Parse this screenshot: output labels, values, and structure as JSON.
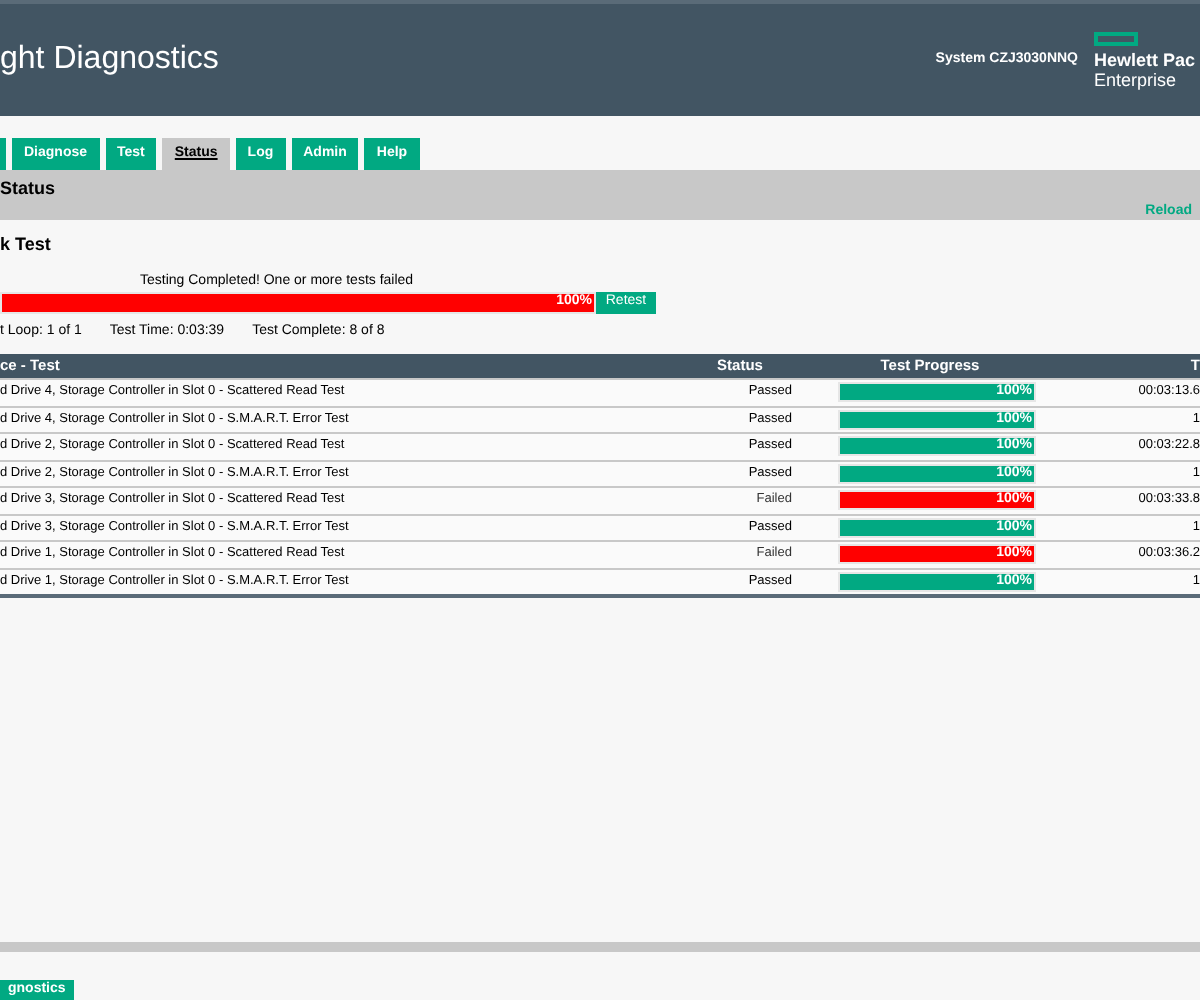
{
  "header": {
    "title": "ght Diagnostics",
    "system": "System CZJ3030NNQ",
    "logo_line_1": "Hewlett Pac",
    "logo_line_2": "Enterprise"
  },
  "tabs": [
    {
      "label": "Diagnose",
      "selected": false
    },
    {
      "label": "Test",
      "selected": false
    },
    {
      "label": "Status",
      "selected": true
    },
    {
      "label": "Log",
      "selected": false
    },
    {
      "label": "Admin",
      "selected": false
    },
    {
      "label": "Help",
      "selected": false
    }
  ],
  "section": {
    "title": "Status",
    "reload": "Reload"
  },
  "test": {
    "title": "k Test",
    "message": "Testing Completed! One or more tests failed",
    "progress": {
      "level": 1,
      "reading": "100%",
      "failed": true
    },
    "retest": "Retest",
    "loop": "t Loop: 1 of 1",
    "time": "Test Time: 0:03:39",
    "complete": "Test Complete: 8 of 8"
  },
  "table": {
    "columns": [
      "ce - Test",
      "Status",
      "Test Progress",
      "T"
    ],
    "rows": [
      {
        "test": "d Drive 4, Storage Controller in Slot 0 - Scattered Read Test",
        "status": "Passed",
        "failed": false,
        "level": 1,
        "reading": "100%",
        "time": "00:03:13.6"
      },
      {
        "test": "d Drive 4, Storage Controller in Slot 0 - S.M.A.R.T. Error Test",
        "status": "Passed",
        "failed": false,
        "level": 1,
        "reading": "100%",
        "time": "1"
      },
      {
        "test": "d Drive 2, Storage Controller in Slot 0 - Scattered Read Test",
        "status": "Passed",
        "failed": false,
        "level": 1,
        "reading": "100%",
        "time": "00:03:22.8"
      },
      {
        "test": "d Drive 2, Storage Controller in Slot 0 - S.M.A.R.T. Error Test",
        "status": "Passed",
        "failed": false,
        "level": 1,
        "reading": "100%",
        "time": "1"
      },
      {
        "test": "d Drive 3, Storage Controller in Slot 0 - Scattered Read Test",
        "status": "Failed",
        "failed": true,
        "level": 1,
        "reading": "100%",
        "time": "00:03:33.8"
      },
      {
        "test": "d Drive 3, Storage Controller in Slot 0 - S.M.A.R.T. Error Test",
        "status": "Passed",
        "failed": false,
        "level": 1,
        "reading": "100%",
        "time": "1"
      },
      {
        "test": "d Drive 1, Storage Controller in Slot 0 - Scattered Read Test",
        "status": "Failed",
        "failed": true,
        "level": 1,
        "reading": "100%",
        "time": "00:03:36.2"
      },
      {
        "test": "d Drive 1, Storage Controller in Slot 0 - S.M.A.R.T. Error Test",
        "status": "Passed",
        "failed": false,
        "level": 1,
        "reading": "100%",
        "time": "1"
      }
    ]
  },
  "footer": {
    "button": "gnostics"
  }
}
